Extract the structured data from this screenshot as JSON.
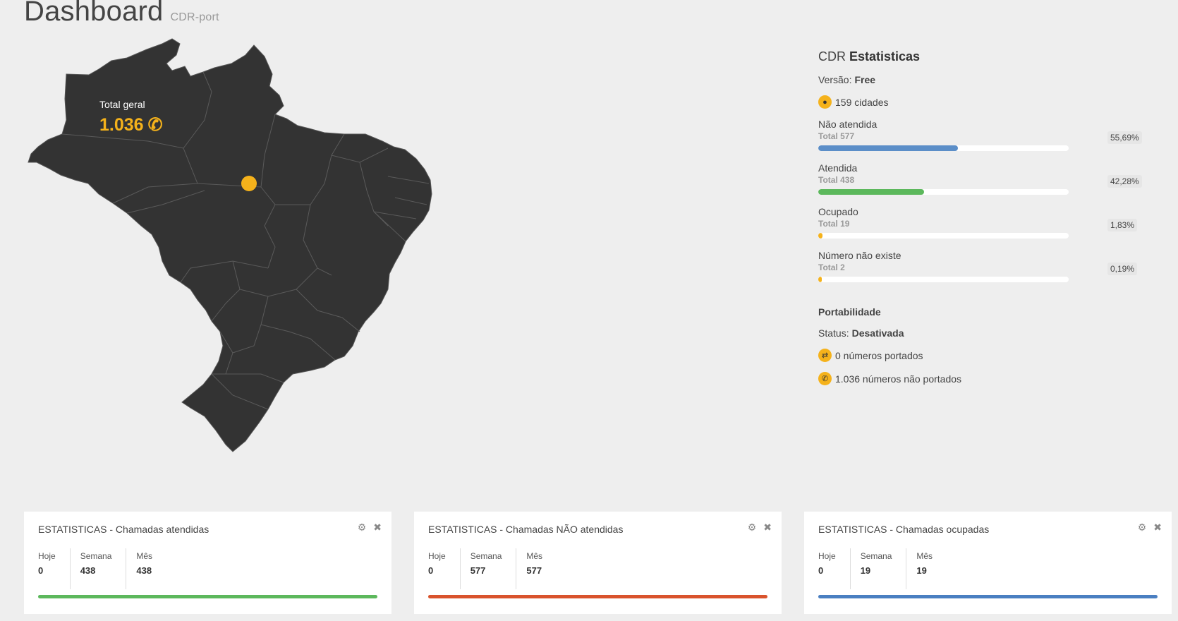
{
  "header": {
    "title": "Dashboard",
    "subtitle": "CDR-port"
  },
  "map": {
    "total_label": "Total geral",
    "total_value": "1.036",
    "map_fill": "#333333",
    "marker_color": "#f5b21b",
    "icons": {
      "phone": "phone-icon"
    }
  },
  "stats": {
    "title_light": "CDR ",
    "title_bold": "Estatisticas",
    "version_label": "Versão:",
    "version_value": "Free",
    "cities": "159 cidades",
    "metrics": [
      {
        "name": "Não atendida",
        "total": "Total 577",
        "percent": "55,69%",
        "fraction": 0.5569,
        "color": "#5b8ec8"
      },
      {
        "name": "Atendida",
        "total": "Total 438",
        "percent": "42,28%",
        "fraction": 0.4228,
        "color": "#5cb85c"
      },
      {
        "name": "Ocupado",
        "total": "Total 19",
        "percent": "1,83%",
        "fraction": 0.0183,
        "color": "#f5b21b"
      },
      {
        "name": "Número não existe",
        "total": "Total 2",
        "percent": "0,19%",
        "fraction": 0.0019,
        "color": "#f5b21b"
      }
    ],
    "portability_title": "Portabilidade",
    "status_label": "Status:",
    "status_value": "Desativada",
    "ported": "0 números portados",
    "not_ported": "1.036 números não portados"
  },
  "cards": [
    {
      "title": "ESTATISTICAS - Chamadas atendidas",
      "labels": [
        "Hoje",
        "Semana",
        "Mês"
      ],
      "values": [
        "0",
        "438",
        "438"
      ],
      "color": "#5cb85c"
    },
    {
      "title": "ESTATISTICAS - Chamadas NÃO atendidas",
      "labels": [
        "Hoje",
        "Semana",
        "Mês"
      ],
      "values": [
        "0",
        "577",
        "577"
      ],
      "color": "#d9532c"
    },
    {
      "title": "ESTATISTICAS - Chamadas ocupadas",
      "labels": [
        "Hoje",
        "Semana",
        "Mês"
      ],
      "values": [
        "0",
        "19",
        "19"
      ],
      "color": "#4a7fc1"
    }
  ],
  "card_icons": {
    "settings": "gear-icon",
    "close": "close-icon"
  }
}
